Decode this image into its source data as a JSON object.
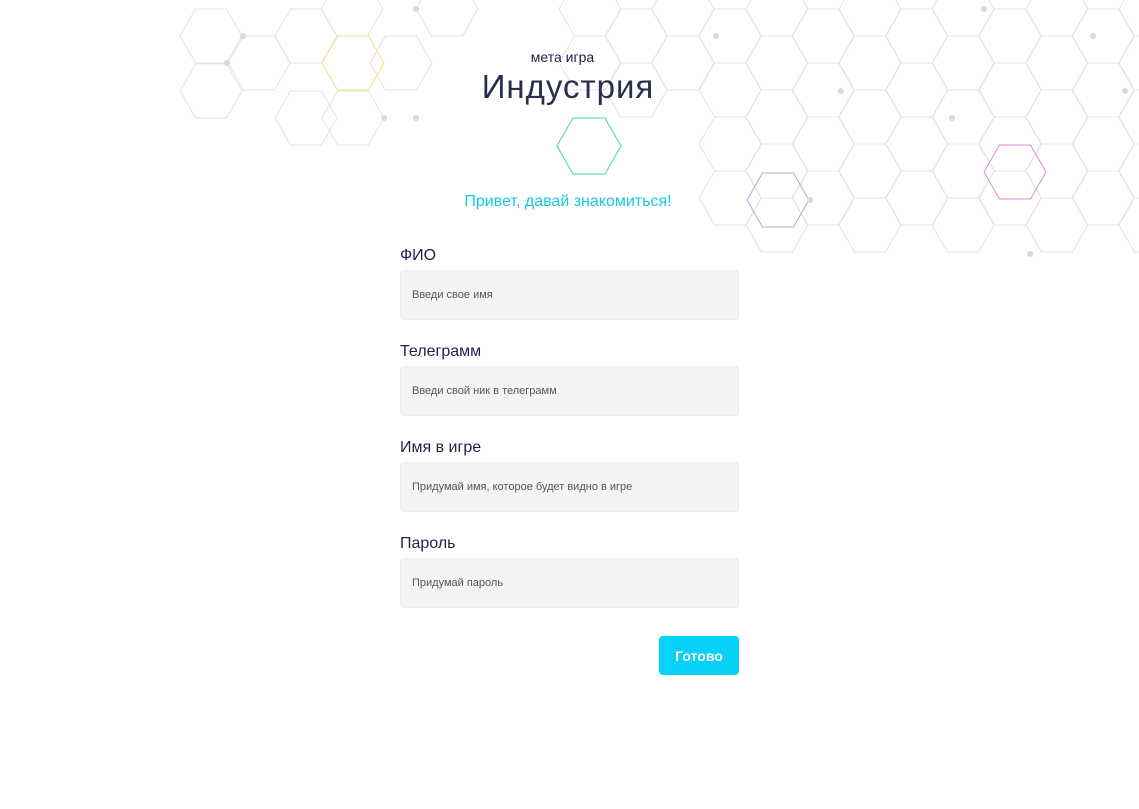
{
  "header": {
    "subtitle": "мета игра",
    "title": "Индустрия"
  },
  "greeting": "Привет, давай знакомиться!",
  "form": {
    "fields": [
      {
        "label": "ФИО",
        "placeholder": "Введи свое имя",
        "value": ""
      },
      {
        "label": "Телеграмм",
        "placeholder": "Введи свой ник в телеграмм",
        "value": ""
      },
      {
        "label": "Имя в игре",
        "placeholder": "Придумай имя, которое будет видно в игре",
        "value": ""
      },
      {
        "label": "Пароль",
        "placeholder": "Придумай пароль",
        "value": ""
      }
    ],
    "submit_label": "Готово"
  },
  "colors": {
    "accent": "#06d1f7",
    "greeting": "#16c9ec",
    "text": "#1f2244",
    "input_bg": "#f4f4f4",
    "hex_grid": "#e3e3e3",
    "hex_yellow": "#f3de8a",
    "hex_green": "#3ed6a6",
    "hex_purple": "#b7a6de",
    "hex_pink": "#e787d6"
  }
}
